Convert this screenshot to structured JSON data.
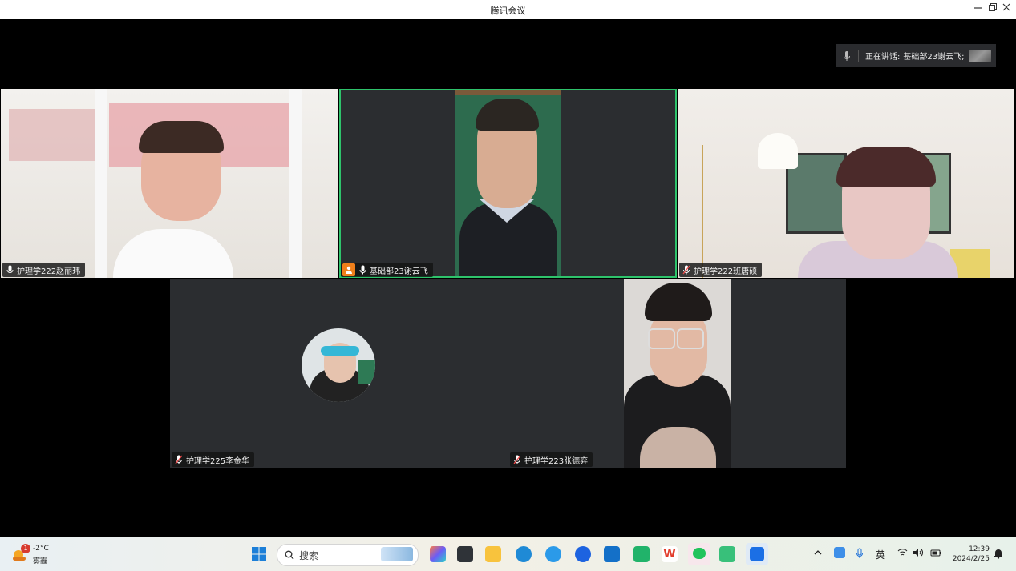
{
  "window": {
    "title": "腾讯会议"
  },
  "speaking": {
    "prefix": "正在讲话:",
    "name": "基础部23谢云飞;"
  },
  "participants": [
    {
      "name": "护理学222赵丽玮"
    },
    {
      "name": "基础部23谢云飞"
    },
    {
      "name": "护理学222班唐硕"
    },
    {
      "name": "护理学225李金华"
    },
    {
      "name": "护理学223张德弈"
    }
  ],
  "taskbar": {
    "weather": {
      "badge": "1",
      "temp": "-2°C",
      "desc": "雾霾"
    },
    "search_placeholder": "搜索",
    "ime": "英",
    "time": "12:39",
    "date": "2024/2/25"
  },
  "colors": {
    "active_border": "#2ec36b",
    "tile_bg": "#2b2d30",
    "host_badge": "#f07f1a"
  }
}
